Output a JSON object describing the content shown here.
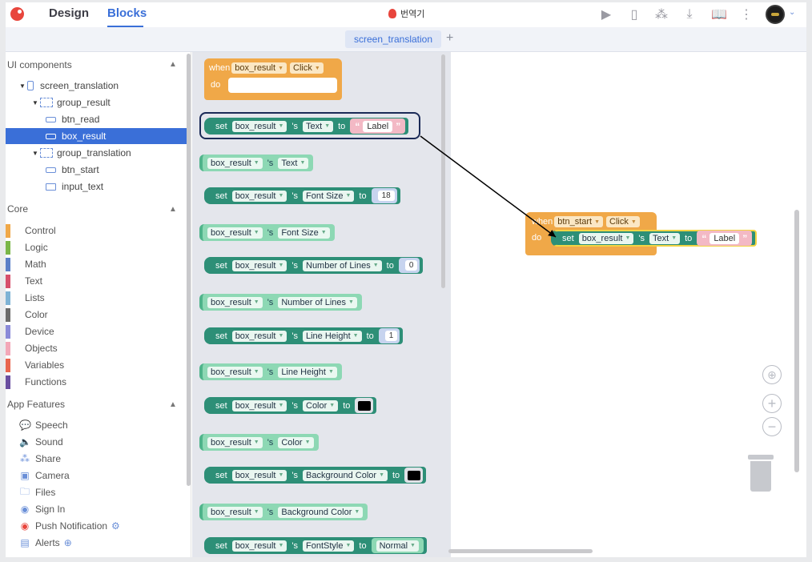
{
  "topbar": {
    "tabs": [
      "Design",
      "Blocks"
    ],
    "project_title": "번역기",
    "icons": [
      "play-icon",
      "device-icon",
      "share-icon",
      "download-icon",
      "book-icon",
      "more-icon"
    ]
  },
  "screen": {
    "tab_label": "screen_translation",
    "add_label": "+"
  },
  "sidebar": {
    "ui_components_title": "UI components",
    "tree": [
      {
        "label": "screen_translation"
      },
      {
        "label": "group_result"
      },
      {
        "label": "btn_read"
      },
      {
        "label": "box_result"
      },
      {
        "label": "group_translation"
      },
      {
        "label": "btn_start"
      },
      {
        "label": "input_text"
      }
    ],
    "core_title": "Core",
    "core": [
      {
        "label": "Control",
        "color": "#f0a848"
      },
      {
        "label": "Logic",
        "color": "#7ab648"
      },
      {
        "label": "Math",
        "color": "#5b7fc7"
      },
      {
        "label": "Text",
        "color": "#d64f6c"
      },
      {
        "label": "Lists",
        "color": "#7fb3d5"
      },
      {
        "label": "Color",
        "color": "#6b6b6b"
      },
      {
        "label": "Device",
        "color": "#8a8ad8"
      },
      {
        "label": "Objects",
        "color": "#f3a8b8"
      },
      {
        "label": "Variables",
        "color": "#e8654e"
      },
      {
        "label": "Functions",
        "color": "#6a4ea0"
      }
    ],
    "features_title": "App Features",
    "features": [
      {
        "label": "Speech",
        "icon": "speech-icon"
      },
      {
        "label": "Sound",
        "icon": "sound-icon"
      },
      {
        "label": "Share",
        "icon": "share-icon"
      },
      {
        "label": "Camera",
        "icon": "camera-icon"
      },
      {
        "label": "Files",
        "icon": "files-icon"
      },
      {
        "label": "Sign In",
        "icon": "sign-in-icon"
      },
      {
        "label": "Push Notification",
        "icon": "push-notification-icon"
      },
      {
        "label": "Alerts",
        "icon": "alerts-icon"
      }
    ]
  },
  "flyout": {
    "when": "when",
    "do": "do",
    "set": "set",
    "s": "'s",
    "to": "to",
    "component": "box_result",
    "event": "Click",
    "props": {
      "text": "Text",
      "font_size": "Font Size",
      "number_of_lines": "Number of Lines",
      "line_height": "Line Height",
      "color": "Color",
      "background_color": "Background Color",
      "font_style": "FontStyle"
    },
    "values": {
      "label": "Label",
      "font_size": "18",
      "number_of_lines": "0",
      "line_height": "1",
      "font_style": "Normal"
    }
  },
  "workspace": {
    "event_component": "btn_start",
    "event": "Click",
    "set_component": "box_result",
    "set_prop": "Text",
    "set_value": "Label"
  }
}
